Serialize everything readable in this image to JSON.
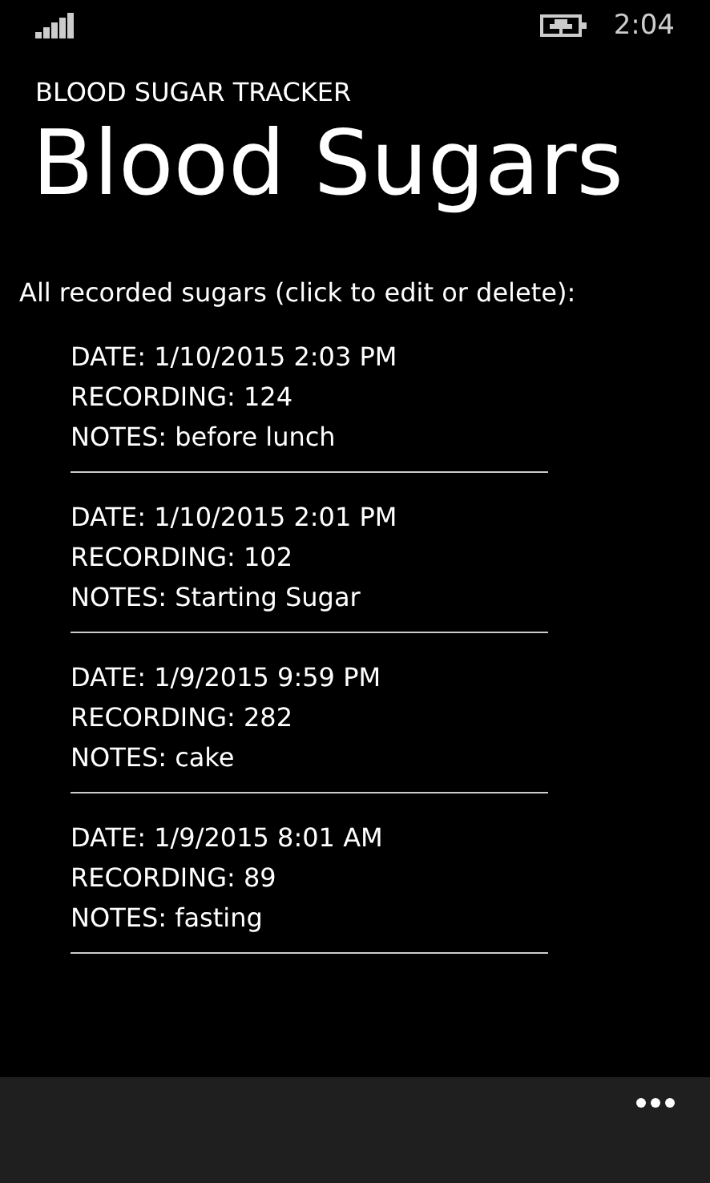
{
  "status_bar": {
    "time": "2:04"
  },
  "app_title": "BLOOD SUGAR TRACKER",
  "page_title": "Blood Sugars",
  "instructions": "All recorded sugars (click to edit or delete):",
  "records": [
    {
      "date": "DATE: 1/10/2015 2:03 PM",
      "recording": "RECORDING: 124",
      "notes": "NOTES: before lunch"
    },
    {
      "date": "DATE: 1/10/2015 2:01 PM",
      "recording": "RECORDING: 102",
      "notes": "NOTES: Starting Sugar"
    },
    {
      "date": "DATE: 1/9/2015 9:59 PM",
      "recording": "RECORDING: 282",
      "notes": "NOTES: cake"
    },
    {
      "date": "DATE: 1/9/2015 8:01 AM",
      "recording": "RECORDING: 89",
      "notes": "NOTES: fasting"
    }
  ]
}
